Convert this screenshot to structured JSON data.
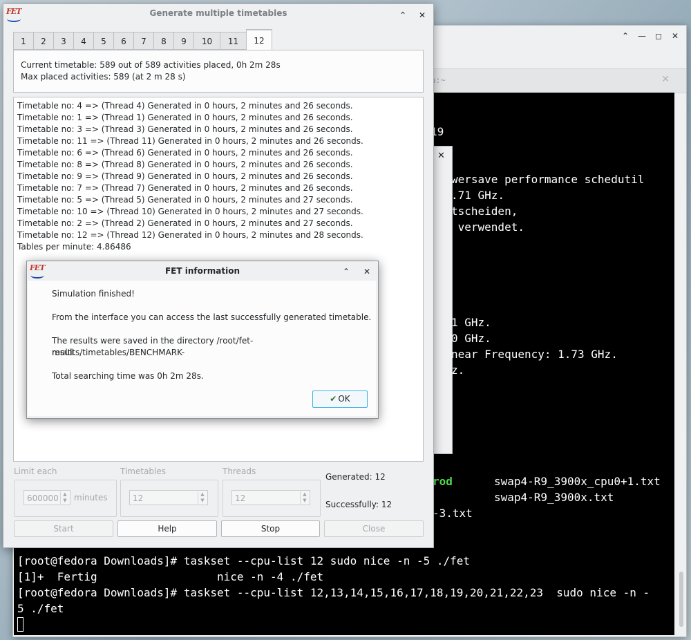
{
  "terminal": {
    "tab_title": "a:~",
    "lines": [
      "19",
      "wersave performance schedutil",
      ".71 GHz.",
      "tscheiden,",
      " verwendet.",
      "1 GHz.",
      "0 GHz.",
      "near Frequency: 1.73 GHz.",
      "z.",
      "rod",
      "swap4-R9_3900x_cpu0+1.txt",
      "swap4-R9_3900x.txt",
      "-3.txt",
      "[root@fedora Downloads]# taskset --cpu-list 12 sudo nice -n -5 ./fet",
      "[1]+  Fertig                  nice -n -4 ./fet",
      "[root@fedora Downloads]# taskset --cpu-list 12,13,14,15,16,17,18,19,20,21,22,23  sudo nice -n -",
      "5 ./fet"
    ]
  },
  "generate_window": {
    "title": "Generate multiple timetables",
    "logo_text": "FET",
    "tabs": [
      "1",
      "2",
      "3",
      "4",
      "5",
      "6",
      "7",
      "8",
      "9",
      "10",
      "11",
      "12"
    ],
    "active_tab": "12",
    "status": {
      "current": "Current timetable: 589 out of 589 activities placed, 0h 2m 28s",
      "max": "Max placed activities: 589 (at 2 m 28 s)"
    },
    "log": [
      "Timetable no: 4 => (Thread 4) Generated in 0 hours, 2 minutes and 26 seconds.",
      "Timetable no: 1 => (Thread 1) Generated in 0 hours, 2 minutes and 26 seconds.",
      "Timetable no: 3 => (Thread 3) Generated in 0 hours, 2 minutes and 26 seconds.",
      "Timetable no: 11 => (Thread 11) Generated in 0 hours, 2 minutes and 26 seconds.",
      "Timetable no: 6 => (Thread 6) Generated in 0 hours, 2 minutes and 26 seconds.",
      "Timetable no: 8 => (Thread 8) Generated in 0 hours, 2 minutes and 26 seconds.",
      "Timetable no: 9 => (Thread 9) Generated in 0 hours, 2 minutes and 26 seconds.",
      "Timetable no: 7 => (Thread 7) Generated in 0 hours, 2 minutes and 26 seconds.",
      "Timetable no: 5 => (Thread 5) Generated in 0 hours, 2 minutes and 27 seconds.",
      "Timetable no: 10 => (Thread 10) Generated in 0 hours, 2 minutes and 27 seconds.",
      "Timetable no: 2 => (Thread 2) Generated in 0 hours, 2 minutes and 27 seconds.",
      "Timetable no: 12 => (Thread 12) Generated in 0 hours, 2 minutes and 28 seconds.",
      "Tables per minute: 4.86486"
    ],
    "limit_each_label": "Limit each",
    "limit_value": "600000",
    "minutes_label": "minutes",
    "timetables_label": "Timetables",
    "timetables_value": "12",
    "threads_label": "Threads",
    "threads_value": "12",
    "generated": "Generated: 12",
    "successfully": "Successfully: 12",
    "buttons": {
      "start": "Start",
      "help": "Help",
      "stop": "Stop",
      "close": "Close"
    }
  },
  "info_dialog": {
    "title": "FET information",
    "logo_text": "FET",
    "msg1": "Simulation finished!",
    "msg2": "From the interface you can access the last successfully generated timetable.",
    "msg3a": "The results were saved in the directory /root/fet-results/timetables/BENCHMARK-",
    "msg3b": "multi.",
    "msg4": "Total searching time was 0h 2m 28s.",
    "ok": "OK"
  },
  "colors": {
    "accent": "#3daee9",
    "terminal_bg": "#000000",
    "terminal_green": "#4ddd4d"
  }
}
